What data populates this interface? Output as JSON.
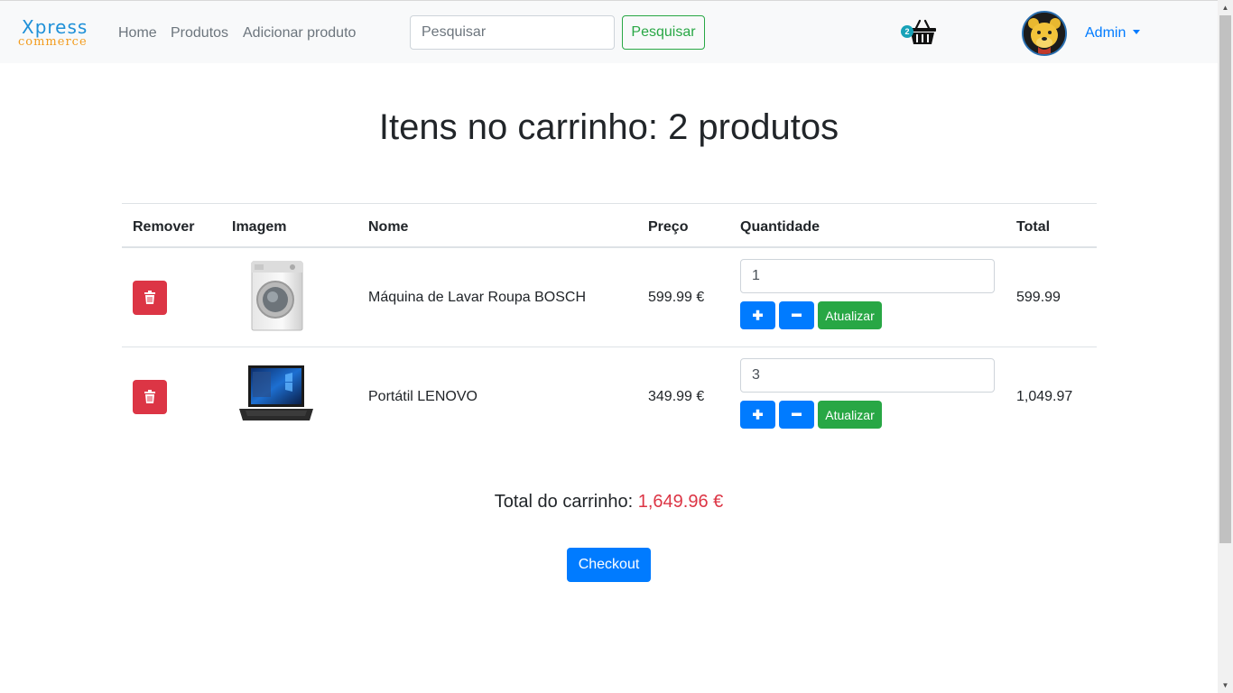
{
  "navbar": {
    "brand_top": "Xpress",
    "brand_bottom": "commerce",
    "links": [
      "Home",
      "Produtos",
      "Adicionar produto"
    ],
    "search_placeholder": "Pesquisar",
    "search_button": "Pesquisar",
    "basket_count": "2",
    "user_label": "Admin"
  },
  "page": {
    "title": "Itens no carrinho: 2 produtos"
  },
  "table": {
    "headers": {
      "remove": "Remover",
      "image": "Imagem",
      "name": "Nome",
      "price": "Preço",
      "quantity": "Quantidade",
      "total": "Total"
    },
    "rows": [
      {
        "name": "Máquina de Lavar Roupa BOSCH",
        "price": "599.99 €",
        "quantity": "1",
        "total": "599.99",
        "image": "washing-machine"
      },
      {
        "name": "Portátil LENOVO",
        "price": "349.99 €",
        "quantity": "3",
        "total": "1,049.97",
        "image": "laptop"
      }
    ],
    "update_label": "Atualizar"
  },
  "summary": {
    "label": "Total do carrinho:",
    "amount": "1,649.96 €"
  },
  "checkout_label": "Checkout",
  "colors": {
    "primary": "#007bff",
    "success": "#28a745",
    "danger": "#dc3545",
    "navbar_bg": "#f8f9fa"
  },
  "icons": [
    "shopping-basket-icon",
    "trash-icon",
    "plus-icon",
    "minus-icon",
    "caret-down-icon"
  ]
}
